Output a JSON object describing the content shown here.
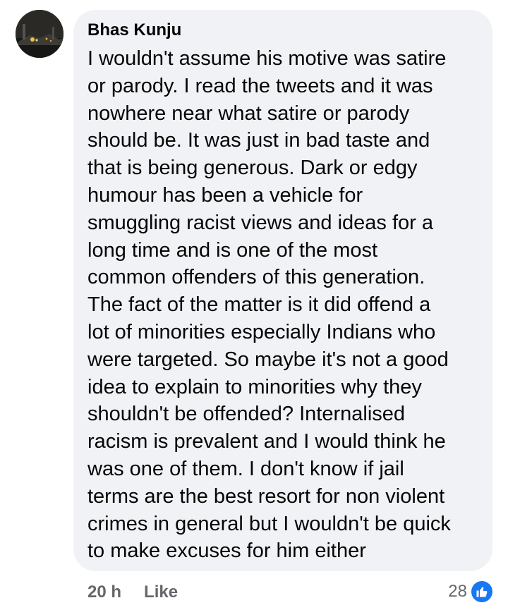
{
  "comment": {
    "author": "Bhas Kunju",
    "lines": [
      "I wouldn't assume his motive was satire",
      "or parody. I read the tweets and it was",
      "nowhere near what satire or parody",
      "should be. It was just in bad taste and",
      "that is being generous. Dark or edgy",
      "humour has been a vehicle for",
      "smuggling racist views and ideas for a",
      "long time and is one of the most",
      "common offenders of this generation.",
      "The fact of the matter is it did offend a",
      "lot of minorities especially Indians who",
      "were targeted. So maybe it's not a good",
      "idea to explain to minorities why they",
      "shouldn't be offended? Internalised",
      "racism is prevalent and I would think he",
      "was one of them. I don't know if jail",
      "terms are the best resort for non violent",
      "crimes in general but I wouldn't be quick",
      "to make excuses for him either"
    ],
    "timestamp": "20 h",
    "like_label": "Like",
    "reaction_count": "28",
    "reaction_icon": "thumbs-up-icon"
  },
  "colors": {
    "bubble_bg": "#f0f2f5",
    "text": "#050505",
    "secondary_text": "#65676b",
    "accent": "#1877f2"
  }
}
